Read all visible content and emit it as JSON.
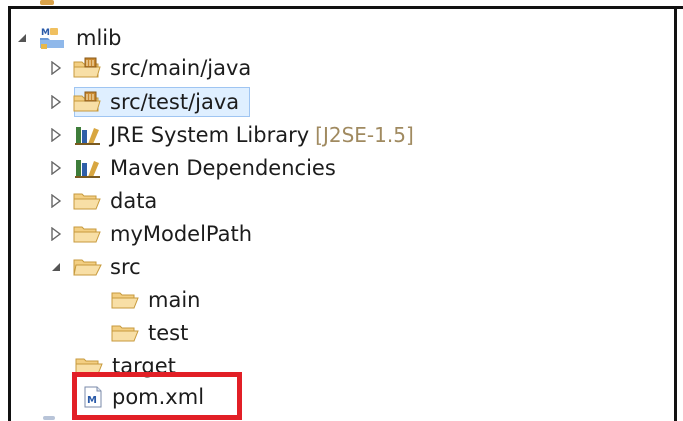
{
  "tree": {
    "project": {
      "label": "mlib",
      "icon": "maven-project-icon",
      "expanded": true
    },
    "items": [
      {
        "label": "src/main/java",
        "icon": "source-package-folder-icon",
        "expanded": false,
        "selected": false
      },
      {
        "label": "src/test/java",
        "icon": "source-package-folder-icon",
        "expanded": false,
        "selected": true
      },
      {
        "label": "JRE System Library",
        "decoration": "[J2SE-1.5]",
        "icon": "library-icon",
        "expanded": false
      },
      {
        "label": "Maven Dependencies",
        "icon": "library-icon",
        "expanded": false
      },
      {
        "label": "data",
        "icon": "folder-icon",
        "expanded": false
      },
      {
        "label": "myModelPath",
        "icon": "folder-icon",
        "expanded": false
      },
      {
        "label": "src",
        "icon": "folder-icon",
        "expanded": true,
        "children": [
          {
            "label": "main",
            "icon": "folder-icon"
          },
          {
            "label": "test",
            "icon": "folder-icon"
          }
        ]
      },
      {
        "label": "target",
        "icon": "folder-icon"
      },
      {
        "label": "pom.xml",
        "icon": "maven-file-icon",
        "highlighted": true
      }
    ]
  },
  "colors": {
    "highlight_border": "#e21f26",
    "selection_bg": "#dfefff",
    "selection_border": "#9fc5f2",
    "folder_fill": "#f7dca0",
    "decoration_text": "#a08a60"
  }
}
